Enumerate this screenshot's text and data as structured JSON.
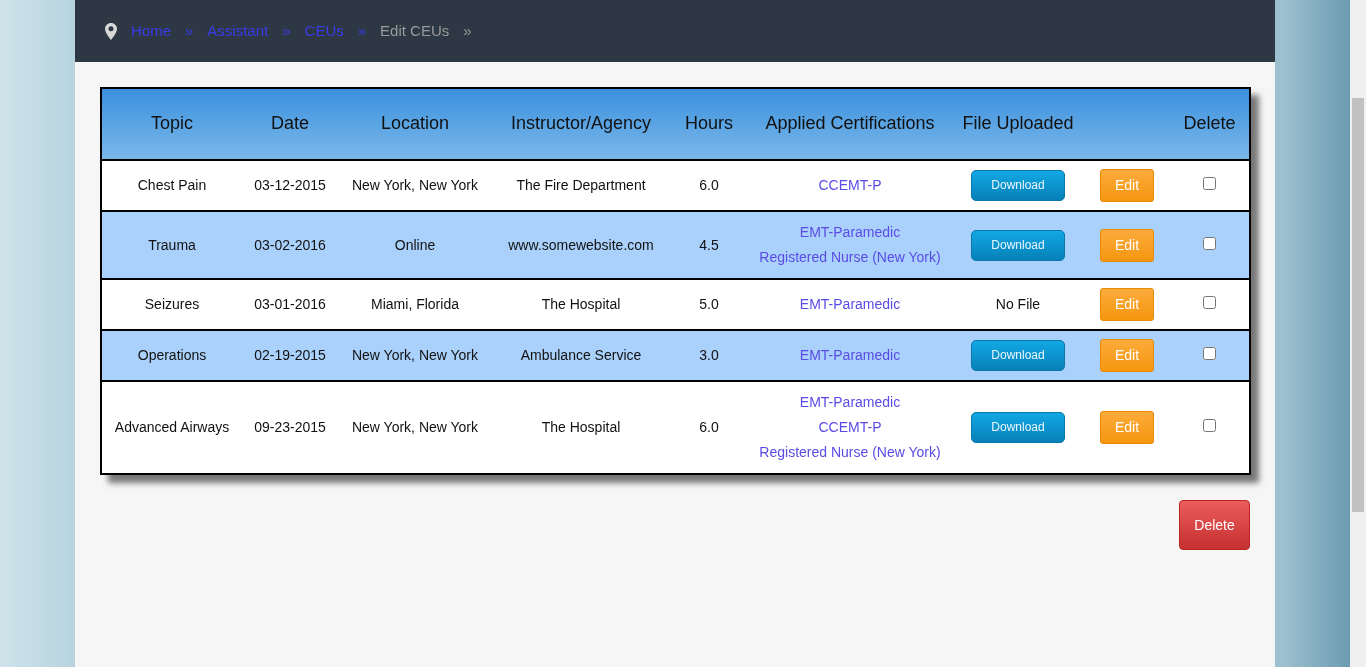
{
  "breadcrumb": [
    {
      "label": "Home",
      "kind": "link",
      "separator": "»"
    },
    {
      "label": "Assistant",
      "kind": "link",
      "separator": "»"
    },
    {
      "label": "CEUs",
      "kind": "link",
      "separator": "»"
    },
    {
      "label": "Edit CEUs",
      "kind": "current",
      "separator": "»"
    }
  ],
  "table": {
    "columns": [
      "Topic",
      "Date",
      "Location",
      "Instructor/Agency",
      "Hours",
      "Applied Certifications",
      "File Uploaded",
      "",
      "Delete"
    ],
    "rows": [
      {
        "topic": "Chest Pain",
        "date": "03-12-2015",
        "location": "New York, New York",
        "instructor": "The Fire Department",
        "hours": "6.0",
        "certifications": [
          "CCEMT-P"
        ],
        "file": {
          "kind": "download",
          "label": "Download"
        },
        "edit": "Edit",
        "checked": false
      },
      {
        "topic": "Trauma",
        "date": "03-02-2016",
        "location": "Online",
        "instructor": "www.somewebsite.com",
        "hours": "4.5",
        "certifications": [
          "EMT-Paramedic",
          "Registered Nurse (New York)"
        ],
        "file": {
          "kind": "download",
          "label": "Download"
        },
        "edit": "Edit",
        "checked": false
      },
      {
        "topic": "Seizures",
        "date": "03-01-2016",
        "location": "Miami, Florida",
        "instructor": "The Hospital",
        "hours": "5.0",
        "certifications": [
          "EMT-Paramedic"
        ],
        "file": {
          "kind": "none",
          "label": "No File"
        },
        "edit": "Edit",
        "checked": false
      },
      {
        "topic": "Operations",
        "date": "02-19-2015",
        "location": "New York, New York",
        "instructor": "Ambulance Service",
        "hours": "3.0",
        "certifications": [
          "EMT-Paramedic"
        ],
        "file": {
          "kind": "download",
          "label": "Download"
        },
        "edit": "Edit",
        "checked": false
      },
      {
        "topic": "Advanced Airways",
        "date": "09-23-2015",
        "location": "New York, New York",
        "instructor": "The Hospital",
        "hours": "6.0",
        "certifications": [
          "EMT-Paramedic",
          "CCEMT-P",
          "Registered Nurse (New York)"
        ],
        "file": {
          "kind": "download",
          "label": "Download"
        },
        "edit": "Edit",
        "checked": false
      }
    ]
  },
  "delete_button": "Delete"
}
